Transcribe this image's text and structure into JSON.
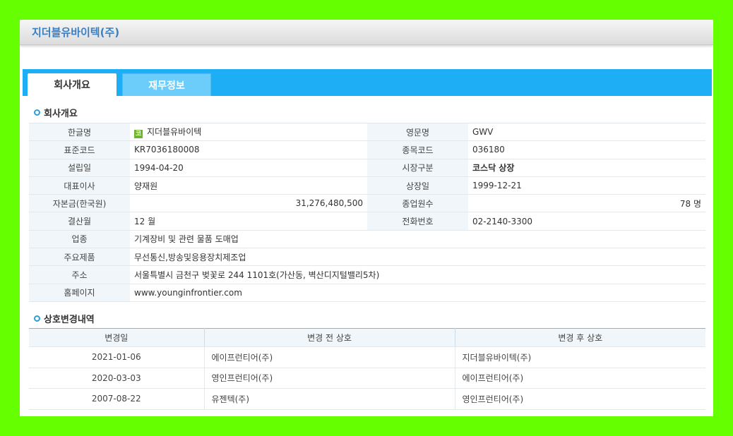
{
  "window": {
    "title": "지더블유바이텍(주)"
  },
  "tabs": [
    {
      "label": "회사개요",
      "active": true
    },
    {
      "label": "재무정보",
      "active": false
    }
  ],
  "overview": {
    "section_title": "회사개요",
    "market_icon": "코",
    "rows": [
      {
        "l1": "한글명",
        "v1": "지더블유바이텍",
        "l2": "영문명",
        "v2": "GWV"
      },
      {
        "l1": "표준코드",
        "v1": "KR7036180008",
        "l2": "종목코드",
        "v2": "036180"
      },
      {
        "l1": "설립일",
        "v1": "1994-04-20",
        "l2": "시장구분",
        "v2": "코스닥 상장"
      },
      {
        "l1": "대표이사",
        "v1": "양재원",
        "l2": "상장일",
        "v2": "1999-12-21"
      },
      {
        "l1": "자본금(한국원)",
        "v1": "31,276,480,500",
        "l2": "종업원수",
        "v2": "78  명"
      },
      {
        "l1": "결산월",
        "v1": "12  월",
        "l2": "전화번호",
        "v2": "02-2140-3300"
      }
    ],
    "full_rows": [
      {
        "l": "업종",
        "v": "기계장비 및 관련 물품 도매업"
      },
      {
        "l": "주요제품",
        "v": "무선통신,방송및응용장치제조업"
      },
      {
        "l": "주소",
        "v": "서울특별시 금천구 벚꽃로 244 1101호(가산동, 벽산디지털밸리5차)"
      },
      {
        "l": "홈페이지",
        "v": "www.younginfrontier.com"
      }
    ]
  },
  "history": {
    "section_title": "상호변경내역",
    "headers": [
      "변경일",
      "변경 전 상호",
      "변경 후 상호"
    ],
    "rows": [
      [
        "2021-01-06",
        "에이프런티어(주)",
        "지더블유바이텍(주)"
      ],
      [
        "2020-03-03",
        "영인프런티어(주)",
        "에이프런티어(주)"
      ],
      [
        "2007-08-22",
        "유젠텍(주)",
        "영인프런티어(주)"
      ]
    ]
  },
  "colors": {
    "accent": "#1eaef5",
    "emphasis": "#f07d1a",
    "background": "#66ff00",
    "title": "#3a7fc4"
  }
}
